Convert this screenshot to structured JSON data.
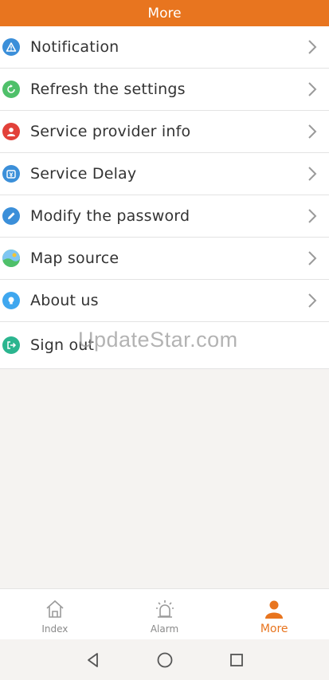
{
  "header": {
    "title": "More"
  },
  "menu": {
    "items": [
      {
        "label": "Notification",
        "icon": "warning-icon",
        "color": "#3b8fd9"
      },
      {
        "label": "Refresh the settings",
        "icon": "refresh-icon",
        "color": "#4fc06a"
      },
      {
        "label": "Service provider info",
        "icon": "person-icon",
        "color": "#e2413a"
      },
      {
        "label": "Service Delay",
        "icon": "calendar-yen-icon",
        "color": "#3b8fd9"
      },
      {
        "label": "Modify the password",
        "icon": "pencil-icon",
        "color": "#3b8fd9"
      },
      {
        "label": "Map source",
        "icon": "landscape-icon",
        "color": "#4fc06a"
      },
      {
        "label": "About us",
        "icon": "lightbulb-icon",
        "color": "#3fa7ef"
      },
      {
        "label": "Sign out",
        "icon": "logout-icon",
        "color": "#2bb58f"
      }
    ]
  },
  "watermark": "UpdateStar.com",
  "tabbar": {
    "tabs": [
      {
        "label": "Index",
        "icon": "home-icon",
        "active": false
      },
      {
        "label": "Alarm",
        "icon": "alarm-siren-icon",
        "active": false
      },
      {
        "label": "More",
        "icon": "person-icon",
        "active": true
      }
    ]
  },
  "colors": {
    "accent": "#e8751f",
    "background": "#f5f3f1"
  }
}
